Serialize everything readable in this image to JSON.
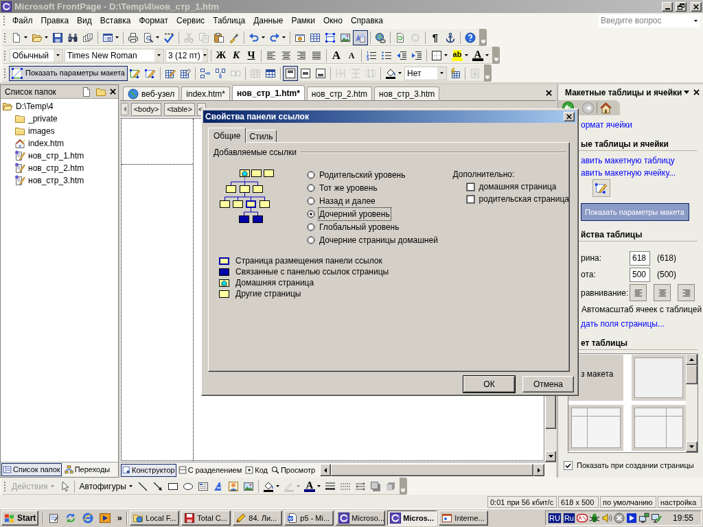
{
  "window": {
    "title": "Microsoft FrontPage - D:\\Temp\\4\\нов_стр_1.htm"
  },
  "menu": [
    "Файл",
    "Правка",
    "Вид",
    "Вставка",
    "Формат",
    "Сервис",
    "Таблица",
    "Данные",
    "Рамки",
    "Окно",
    "Справка"
  ],
  "help_search": {
    "placeholder": "Введите вопрос"
  },
  "toolbars": [
    {
      "groups": [
        [
          {
            "kind": "split",
            "pressed": false,
            "disabled": false
          },
          {
            "kind": "split",
            "pressed": false,
            "disabled": false
          },
          {
            "kind": "button",
            "pressed": false,
            "disabled": false
          },
          {
            "kind": "button",
            "pressed": false,
            "disabled": false
          },
          {
            "kind": "button",
            "pressed": false,
            "disabled": false
          }
        ],
        [
          {
            "kind": "split",
            "pressed": false,
            "disabled": false
          }
        ],
        [
          {
            "kind": "button",
            "pressed": false,
            "disabled": false
          },
          {
            "kind": "split",
            "pressed": false,
            "disabled": false
          },
          {
            "kind": "button",
            "pressed": false,
            "disabled": false
          }
        ],
        [
          {
            "kind": "button",
            "pressed": false,
            "disabled": true
          },
          {
            "kind": "button",
            "pressed": false,
            "disabled": true
          },
          {
            "kind": "button",
            "pressed": false,
            "disabled": false
          },
          {
            "kind": "button",
            "pressed": false,
            "disabled": false
          }
        ],
        [
          {
            "kind": "split",
            "pressed": false,
            "disabled": false
          },
          {
            "kind": "split",
            "pressed": false,
            "disabled": false
          }
        ],
        [
          {
            "kind": "button",
            "pressed": false,
            "disabled": false
          },
          {
            "kind": "button",
            "pressed": false,
            "disabled": false
          },
          {
            "kind": "button",
            "pressed": false,
            "disabled": false
          },
          {
            "kind": "button",
            "pressed": false,
            "disabled": false
          },
          {
            "kind": "button",
            "pressed": true,
            "disabled": false
          }
        ],
        [
          {
            "kind": "button",
            "pressed": false,
            "disabled": false
          }
        ],
        [
          {
            "kind": "button",
            "pressed": false,
            "disabled": false
          },
          {
            "kind": "button",
            "pressed": false,
            "disabled": true
          }
        ],
        [
          {
            "kind": "glyph",
            "label": "¶",
            "pressed": false,
            "disabled": false
          },
          {
            "kind": "button",
            "pressed": false,
            "disabled": false
          }
        ],
        [
          {
            "kind": "button",
            "pressed": false,
            "disabled": false
          }
        ]
      ]
    },
    {
      "groups": [
        [
          {
            "kind": "combo",
            "value": "Обычный"
          },
          {
            "kind": "combo",
            "value": "Times New Roman"
          },
          {
            "kind": "combo",
            "value": "3 (12 пт)"
          }
        ],
        [
          {
            "kind": "glyph",
            "label": "Ж",
            "pressed": false,
            "disabled": false
          },
          {
            "kind": "glyph",
            "label": "К",
            "pressed": false,
            "disabled": false
          },
          {
            "kind": "glyph",
            "label": "Ч",
            "pressed": false,
            "disabled": false
          }
        ],
        [
          {
            "kind": "button",
            "pressed": false,
            "disabled": false
          },
          {
            "kind": "button",
            "pressed": false,
            "disabled": false
          },
          {
            "kind": "button",
            "pressed": false,
            "disabled": false
          },
          {
            "kind": "button",
            "pressed": false,
            "disabled": false
          }
        ],
        [
          {
            "kind": "glyph",
            "label": "A",
            "pressed": false,
            "disabled": false
          },
          {
            "kind": "glyph",
            "label": "A",
            "pressed": false,
            "disabled": false
          }
        ],
        [
          {
            "kind": "button",
            "pressed": false,
            "disabled": false
          },
          {
            "kind": "button",
            "pressed": false,
            "disabled": false
          },
          {
            "kind": "button",
            "pressed": false,
            "disabled": false
          },
          {
            "kind": "button",
            "pressed": false,
            "disabled": false
          }
        ],
        [
          {
            "kind": "split",
            "pressed": false,
            "disabled": false
          },
          {
            "kind": "glyph_split",
            "label": "ab",
            "color": "#ffff00",
            "pressed": false,
            "disabled": false
          },
          {
            "kind": "glyph_split",
            "label": "A",
            "color": "#000000",
            "pressed": false,
            "disabled": false
          }
        ]
      ]
    },
    {
      "groups": [
        [
          {
            "kind": "text_button",
            "label": "Показать параметры макета",
            "pressed": true,
            "disabled": false
          },
          {
            "kind": "button",
            "pressed": false,
            "disabled": false
          },
          {
            "kind": "button",
            "pressed": false,
            "disabled": false
          }
        ],
        [
          {
            "kind": "button",
            "pressed": false,
            "disabled": false
          },
          {
            "kind": "button",
            "pressed": false,
            "disabled": false
          }
        ],
        [
          {
            "kind": "button",
            "pressed": false,
            "disabled": false
          },
          {
            "kind": "button",
            "pressed": false,
            "disabled": false
          },
          {
            "kind": "button",
            "pressed": false,
            "disabled": true
          }
        ],
        [
          {
            "kind": "button",
            "pressed": false,
            "disabled": true
          },
          {
            "kind": "button",
            "pressed": false,
            "disabled": false
          }
        ],
        [
          {
            "kind": "button",
            "pressed": true,
            "disabled": false
          },
          {
            "kind": "button",
            "pressed": false,
            "disabled": false
          },
          {
            "kind": "button",
            "pressed": false,
            "disabled": false
          }
        ],
        [
          {
            "kind": "button",
            "pressed": false,
            "disabled": true
          },
          {
            "kind": "button",
            "pressed": false,
            "disabled": true
          },
          {
            "kind": "button",
            "pressed": false,
            "disabled": true
          }
        ],
        [
          {
            "kind": "split",
            "pressed": false,
            "disabled": false
          },
          {
            "kind": "combo",
            "value": "Нет"
          },
          {
            "kind": "button",
            "pressed": false,
            "disabled": false
          }
        ],
        [
          {
            "kind": "button",
            "pressed": false,
            "disabled": true
          }
        ]
      ]
    }
  ],
  "folder_list": {
    "title": "Список папок",
    "tree": [
      {
        "label": "D:\\Temp\\4",
        "kind": "root",
        "children": [
          {
            "label": "_private",
            "kind": "folder"
          },
          {
            "label": "images",
            "kind": "folder"
          },
          {
            "label": "index.htm",
            "kind": "home_page"
          },
          {
            "label": "нов_стр_1.htm",
            "kind": "page"
          },
          {
            "label": "нов_стр_2.htm",
            "kind": "page"
          },
          {
            "label": "нов_стр_3.htm",
            "kind": "page"
          }
        ]
      }
    ],
    "tabs": [
      {
        "label": "Список папок",
        "selected": true
      },
      {
        "label": "Переходы",
        "selected": false
      }
    ]
  },
  "editor": {
    "tabs": [
      {
        "label": "веб-узел",
        "kind": "site",
        "selected": false
      },
      {
        "label": "index.htm*",
        "kind": "page",
        "selected": false
      },
      {
        "label": "нов_стр_1.htm*",
        "kind": "page",
        "selected": true
      },
      {
        "label": "нов_стр_2.htm",
        "kind": "page",
        "selected": false
      },
      {
        "label": "нов_стр_3.htm",
        "kind": "page",
        "selected": false
      }
    ],
    "breadcrumbs": [
      "<body>",
      "<table>",
      "<"
    ],
    "view_tabs": [
      {
        "label": "Конструктор",
        "selected": true
      },
      {
        "label": "С разделением",
        "selected": false
      },
      {
        "label": "Код",
        "selected": false
      },
      {
        "label": "Просмотр",
        "selected": false
      }
    ]
  },
  "dialog": {
    "title": "Свойства панели ссылок",
    "tabs": [
      {
        "label": "Общие",
        "selected": true
      },
      {
        "label": "Стиль",
        "selected": false
      }
    ],
    "group": "Добавляемые ссылки",
    "levels": [
      {
        "label": "Родительский уровень",
        "selected": false
      },
      {
        "label": "Тот же уровень",
        "selected": false
      },
      {
        "label": "Назад и далее",
        "selected": false
      },
      {
        "label": "Дочерний уровень",
        "selected": true
      },
      {
        "label": "Глобальный уровень",
        "selected": false
      },
      {
        "label": "Дочерние страницы домашней",
        "selected": false
      }
    ],
    "extra": {
      "label": "Дополнительно:",
      "options": [
        {
          "label": "домашняя страница",
          "checked": false
        },
        {
          "label": "родительская страница",
          "checked": false
        }
      ]
    },
    "legend": [
      {
        "kind": "current",
        "label": "Страница размещения панели ссылок"
      },
      {
        "kind": "linked",
        "label": "Связанные с панелью ссылок страницы"
      },
      {
        "kind": "home",
        "label": "Домашняя страница"
      },
      {
        "kind": "other",
        "label": "Другие страницы"
      }
    ],
    "buttons": [
      "ОК",
      "Отмена"
    ]
  },
  "task_pane": {
    "title": "Макетные таблицы и ячейки",
    "top_link": "ормат ячейки",
    "section_1": "ые таблицы и ячейки",
    "links": [
      "авить макетную таблицу",
      "авить макетную ячейку..."
    ],
    "layout_button": {
      "label": "Показать параметры макета",
      "pressed": true
    },
    "section_2": "йства таблицы",
    "width": {
      "label": "рина:",
      "value": "618",
      "actual": "(618)"
    },
    "height": {
      "label": "ота:",
      "value": "500",
      "actual": "(500)"
    },
    "alignment": "равнивание:",
    "autofit": "Автомасштаб ячеек с таблицей",
    "margins_link": "дать поля страницы...",
    "section_3": "ет таблицы",
    "gallery_first_tile": "з макета",
    "show_on_create": {
      "label": "Показать при создании страницы",
      "checked": true
    }
  },
  "drawing_toolbar": {
    "groups": [
      [
        {
          "kind": "text_split",
          "label": "Действия",
          "pressed": false,
          "disabled": true
        },
        {
          "kind": "button",
          "pressed": false,
          "disabled": false
        }
      ],
      [
        {
          "kind": "text_split",
          "label": "Автофигуры",
          "pressed": false,
          "disabled": false
        },
        {
          "kind": "button",
          "pressed": false,
          "disabled": false
        },
        {
          "kind": "button",
          "pressed": false,
          "disabled": false
        },
        {
          "kind": "button",
          "pressed": false,
          "disabled": false
        },
        {
          "kind": "button",
          "pressed": false,
          "disabled": false
        },
        {
          "kind": "button",
          "pressed": false,
          "disabled": false
        },
        {
          "kind": "button",
          "pressed": false,
          "disabled": false
        },
        {
          "kind": "button",
          "pressed": false,
          "disabled": false
        },
        {
          "kind": "button",
          "pressed": false,
          "disabled": false
        }
      ],
      [
        {
          "kind": "split",
          "pressed": false,
          "disabled": false
        },
        {
          "kind": "split",
          "pressed": false,
          "disabled": true
        },
        {
          "kind": "glyph_split",
          "label": "A",
          "color": "#000080",
          "pressed": false,
          "disabled": false
        },
        {
          "kind": "button",
          "pressed": false,
          "disabled": false
        },
        {
          "kind": "button",
          "pressed": false,
          "disabled": false
        },
        {
          "kind": "button",
          "pressed": false,
          "disabled": false
        },
        {
          "kind": "button",
          "pressed": false,
          "disabled": false
        },
        {
          "kind": "button",
          "pressed": false,
          "disabled": false
        }
      ]
    ]
  },
  "status_bar": [
    "0:01 при 56 кбит/с",
    "618 x 500",
    "по умолчанию",
    "настройка"
  ],
  "taskbar": {
    "start": "Start",
    "more": "»",
    "tasks": [
      {
        "label": "Local F...",
        "selected": false
      },
      {
        "label": "Total C...",
        "selected": false
      },
      {
        "label": "84. Ли...",
        "selected": false
      },
      {
        "label": "p5 - Mi...",
        "selected": false
      },
      {
        "label": "Microso...",
        "selected": false
      },
      {
        "label": "Micros...",
        "selected": true
      },
      {
        "label": "Interne...",
        "selected": false
      }
    ],
    "languages": [
      "RU",
      "Ru"
    ],
    "clock": "19:55"
  }
}
